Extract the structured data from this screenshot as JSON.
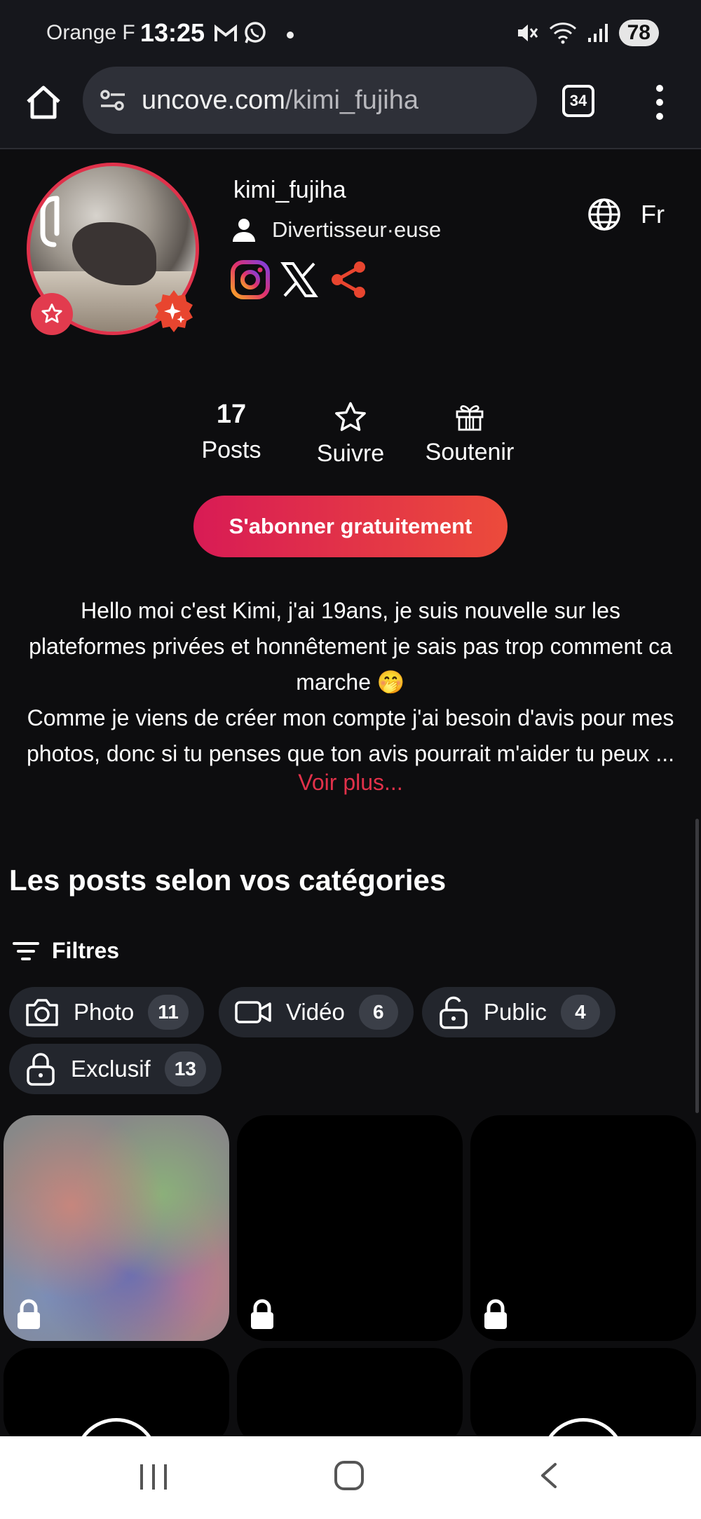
{
  "status_bar": {
    "carrier": "Orange F",
    "time": "13:25",
    "battery": "78",
    "icons": [
      "gmail-icon",
      "whatsapp-icon",
      "dot",
      "mute-icon",
      "wifi-6e-icon",
      "signal-icon"
    ]
  },
  "browser": {
    "url_host": "uncove.com",
    "url_path": "/kimi_fujiha",
    "tab_count": "34"
  },
  "profile": {
    "username": "kimi_fujiha",
    "role": "Divertisseur·euse",
    "language": "Fr",
    "socials": [
      "instagram-icon",
      "x-icon",
      "share-icon"
    ]
  },
  "stats": {
    "posts_count": "17",
    "posts_label": "Posts",
    "follow_label": "Suivre",
    "support_label": "Soutenir"
  },
  "subscribe_label": "S'abonner gratuitement",
  "bio": {
    "line1": "Hello moi c'est Kimi, j'ai 19ans, je suis nouvelle sur les",
    "line2": "plateformes privées et honnêtement je sais pas trop comment ca",
    "line3": "marche 🤭",
    "line4": "Comme je viens de créer mon compte j'ai besoin d'avis pour mes",
    "line5": "photos, donc si tu penses que ton avis pourrait m'aider tu peux ...",
    "more": "Voir plus..."
  },
  "posts_section": {
    "title": "Les posts selon vos catégories",
    "filters_label": "Filtres",
    "chips": [
      {
        "label": "Photo",
        "count": "11",
        "icon": "camera-icon"
      },
      {
        "label": "Vidéo",
        "count": "6",
        "icon": "video-icon"
      },
      {
        "label": "Public",
        "count": "4",
        "icon": "unlock-icon"
      },
      {
        "label": "Exclusif",
        "count": "13",
        "icon": "lock-icon"
      }
    ]
  },
  "colors": {
    "accent": "#e1314a",
    "background": "#0d0d0f",
    "chip_bg": "#23262d"
  }
}
